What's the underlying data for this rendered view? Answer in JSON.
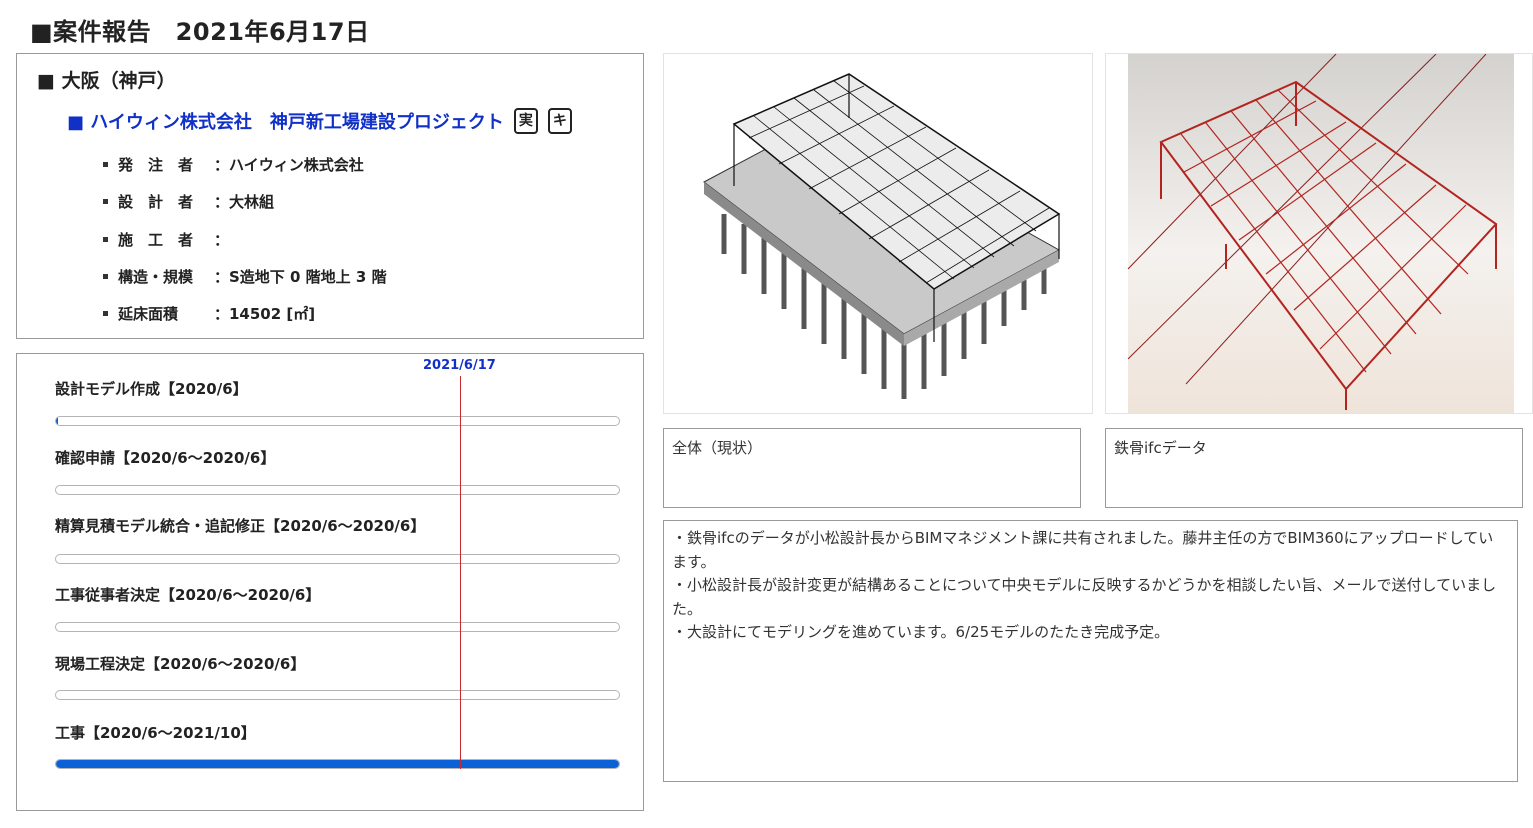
{
  "page": {
    "title": "■案件報告　2021年6月17日"
  },
  "info": {
    "region": "■ 大阪（神戸）",
    "project": {
      "title": "■ ハイウィン株式会社　神戸新工場建設プロジェクト",
      "tags": [
        "実",
        "キ"
      ]
    },
    "details": [
      {
        "label": "発　注　者",
        "value": "：ハイウィン株式会社"
      },
      {
        "label": "設　計　者",
        "value": "：大林組"
      },
      {
        "label": "施　工　者",
        "value": "："
      },
      {
        "label": "構造・規模",
        "value": "：S造地下 0 階地上 3 階"
      },
      {
        "label": "延床面積",
        "value": "：14502 [㎡]"
      }
    ]
  },
  "schedule": {
    "today_label": "2021/6/17",
    "tasks": [
      {
        "label": "設計モデル作成【2020/6】",
        "progress": 0.004
      },
      {
        "label": "確認申請【2020/6～2020/6】",
        "progress": 0
      },
      {
        "label": "精算見積モデル統合・追記修正【2020/6～2020/6】",
        "progress": 0
      },
      {
        "label": "工事従事者決定【2020/6～2020/6】",
        "progress": 0
      },
      {
        "label": "現場工程決定【2020/6～2020/6】",
        "progress": 0
      },
      {
        "label": "工事【2020/6～2021/10】",
        "progress": 1.0
      }
    ]
  },
  "images": {
    "caption_1": "全体（現状）",
    "caption_2": "鉄骨ifcデータ"
  },
  "notes": "・鉄骨ifcのデータが小松設計長からBIMマネジメント課に共有されました。藤井主任の方でBIM360にアップロードしています。\n・小松設計長が設計変更が結構あることについて中央モデルに反映するかどうかを相談したい旨、メールで送付していました。\n・大設計にてモデリングを進めています。6/25モデルのたたき完成予定。",
  "colors": {
    "accent_blue": "#1030c8",
    "bar_fill": "#0a62d6",
    "today_line": "#c8282e",
    "steel_red": "#b3241f"
  }
}
